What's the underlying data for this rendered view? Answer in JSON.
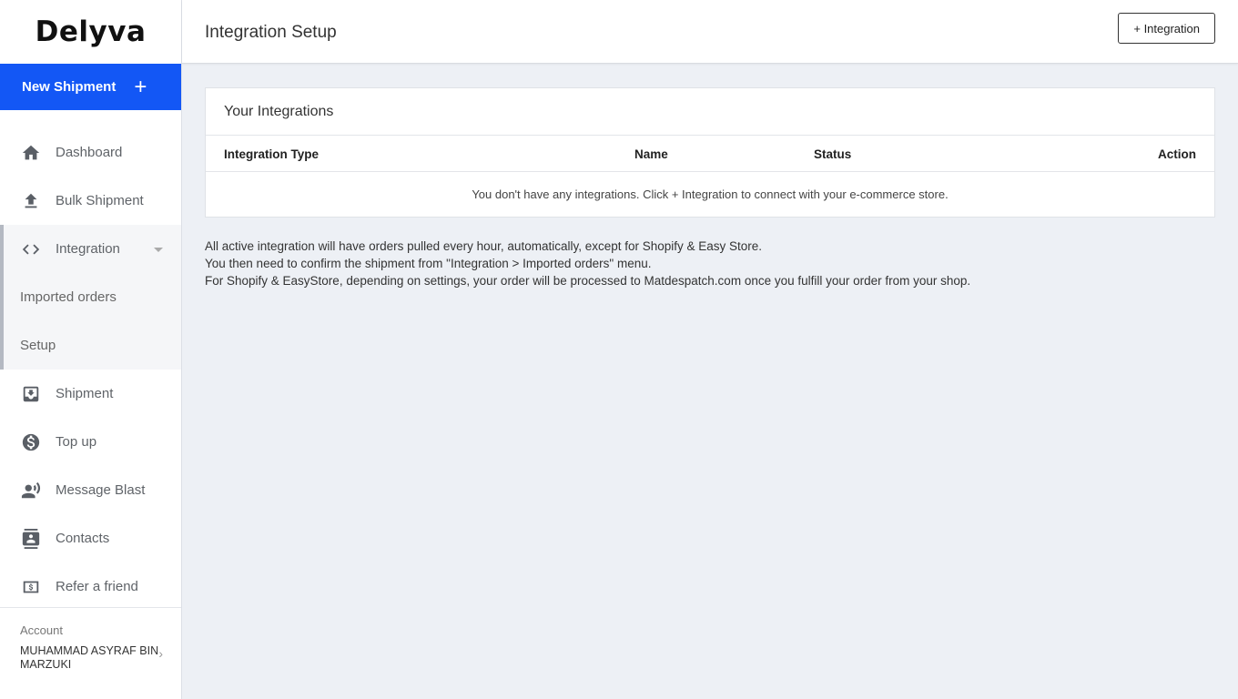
{
  "brand": {
    "logo_text": "Delyva"
  },
  "sidebar": {
    "new_shipment_label": "New Shipment",
    "items": [
      {
        "label": "Dashboard",
        "icon": "home-icon"
      },
      {
        "label": "Bulk Shipment",
        "icon": "upload-icon"
      },
      {
        "label": "Integration",
        "icon": "code-icon"
      },
      {
        "label": "Shipment",
        "icon": "inbox-download-icon"
      },
      {
        "label": "Top up",
        "icon": "dollar-circle-icon"
      },
      {
        "label": "Message Blast",
        "icon": "person-speaking-icon"
      },
      {
        "label": "Contacts",
        "icon": "contact-book-icon"
      },
      {
        "label": "Refer a friend",
        "icon": "money-card-icon"
      }
    ],
    "integration_sub": [
      "Imported orders",
      "Setup"
    ],
    "account": {
      "label": "Account",
      "name": "MUHAMMAD ASYRAF BIN MARZUKI"
    }
  },
  "header": {
    "title": "Integration Setup",
    "add_button": "+ Integration"
  },
  "card": {
    "title": "Your Integrations",
    "columns": [
      "Integration Type",
      "Name",
      "Status",
      "Action"
    ],
    "empty_message": "You don't have any integrations. Click + Integration to connect with your e-commerce store."
  },
  "notes": [
    "All active integration will have orders pulled every hour, automatically, except for Shopify & Easy Store.",
    "You then need to confirm the shipment from \"Integration > Imported orders\" menu.",
    "For Shopify & EasyStore, depending on settings, your order will be processed to Matdespatch.com once you fulfill your order from your shop."
  ],
  "colors": {
    "accent": "#1357f5",
    "background": "#edf0f5"
  }
}
